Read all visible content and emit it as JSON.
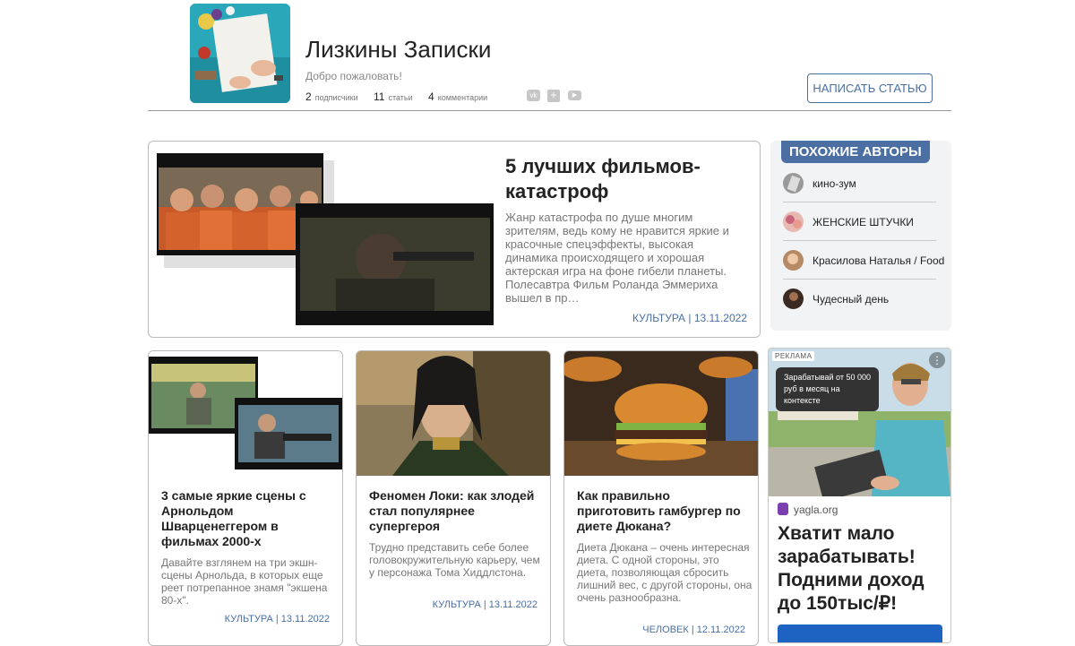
{
  "header": {
    "title": "Лизкины Записки",
    "greeting": "Добро пожаловать!",
    "stats": [
      {
        "value": "2",
        "label": "подписчики"
      },
      {
        "value": "11",
        "label": "статьи"
      },
      {
        "value": "4",
        "label": "комментарии"
      }
    ],
    "socials": [
      "vk-icon",
      "plus-icon",
      "youtube-icon"
    ],
    "write_button": "НАПИСАТЬ СТАТЬЮ"
  },
  "featured": {
    "title": "5 лучших фильмов-катастроф",
    "description": "Жанр катастрофа по душе многим зрителям, ведь кому не нравится яркие и красочные спецэффекты, высокая динамика происходящего и хорошая актерская игра на фоне гибели планеты. Полесавтра Фильм Роланда Эммериха вышел в пр…",
    "meta": "КУЛЬТУРА | 13.11.2022"
  },
  "authors": {
    "title": "ПОХОЖИЕ АВТОРЫ",
    "items": [
      {
        "name": "кино-зум"
      },
      {
        "name": "ЖЕНСКИЕ ШТУЧКИ"
      },
      {
        "name": "Красилова Наталья / Food"
      },
      {
        "name": "Чудесный день"
      }
    ]
  },
  "cards": [
    {
      "title": "3 самые яркие сцены с Арнольдом Шварценеггером в фильмах 2000-х",
      "desc": "Давайте взглянем на три экшн-сцены Арнольда, в которых еще реет потрепанное знамя \"экшена 80-х\".",
      "meta": "КУЛЬТУРА | 13.11.2022"
    },
    {
      "title": "Феномен Локи: как злодей стал популярнее супергероя",
      "desc": "Трудно представить себе более головокружительную карьеру, чем у персонажа Тома Хиддлстона.",
      "meta": "КУЛЬТУРА | 13.11.2022"
    },
    {
      "title": "Как правильно приготовить гамбургер по диете Дюкана?",
      "desc": "Диета Дюкана – очень интересная диета. С одной стороны, это диета, позволяющая сбросить лишний вес, с другой стороны, она очень разнообразна.",
      "meta": "ЧЕЛОВЕК | 12.11.2022"
    }
  ],
  "ad": {
    "label": "РЕКЛАМА",
    "bubble": "Зарабатывай от 50 000 руб в месяц на контексте",
    "domain": "yagla.org",
    "headline": "Хватит мало зарабатывать! Подними доход до 150тыс/₽!"
  },
  "colors": {
    "accent": "#4b6fa3",
    "ad_cta": "#1e62c2"
  }
}
